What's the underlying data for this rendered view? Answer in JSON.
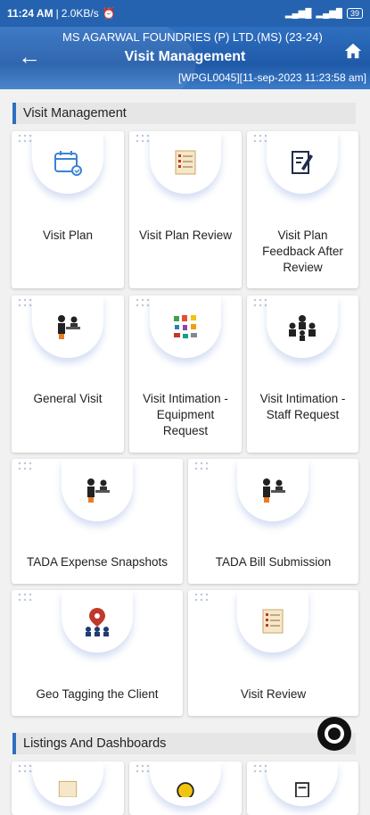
{
  "status_bar": {
    "time": "11:24 AM",
    "speed": "2.0KB/s",
    "battery": "39"
  },
  "header": {
    "company": "MS AGARWAL FOUNDRIES (P) LTD.(MS) (23-24)",
    "title": "Visit Management",
    "code": "[WPGL0045][11-sep-2023 11:23:58 am]"
  },
  "sections": {
    "visit_management": "Visit Management",
    "listings": "Listings And Dashboards"
  },
  "tiles": [
    {
      "label": "Visit Plan",
      "icon": "calendar-icon"
    },
    {
      "label": "Visit Plan Review",
      "icon": "review-list-icon"
    },
    {
      "label": "Visit Plan Feedback After Review",
      "icon": "notepad-pen-icon"
    },
    {
      "label": "General Visit",
      "icon": "meeting-desk-icon"
    },
    {
      "label": "Visit Intimation - Equipment Request",
      "icon": "equipment-icon"
    },
    {
      "label": "Visit Intimation - Staff Request",
      "icon": "staff-group-icon"
    },
    {
      "label": "TADA Expense Snapshots",
      "icon": "meeting-desk-icon"
    },
    {
      "label": "TADA Bill Submission",
      "icon": "meeting-desk-icon"
    },
    {
      "label": "Geo Tagging the Client",
      "icon": "geo-tag-icon"
    },
    {
      "label": "Visit Review",
      "icon": "review-list-icon"
    }
  ]
}
